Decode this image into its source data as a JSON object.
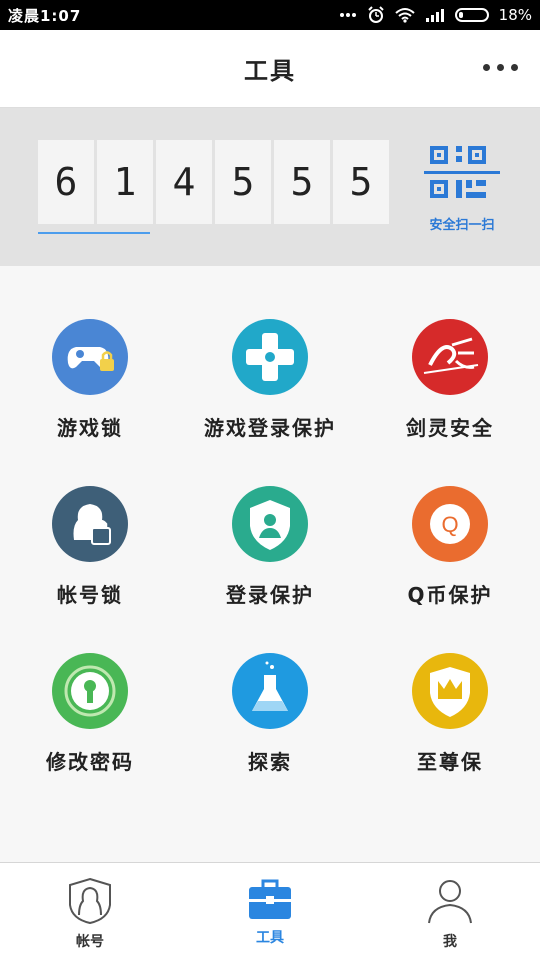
{
  "status_bar": {
    "time": "凌晨1:07",
    "battery": "18%",
    "battery_fraction": 0.18,
    "icons": [
      "dots-icon",
      "alarm-icon",
      "wifi-icon",
      "signal-icon",
      "battery-icon"
    ]
  },
  "header": {
    "title": "工具",
    "more_icon": "more-dots-icon"
  },
  "token": {
    "digits": [
      "6",
      "1",
      "4",
      "5",
      "5",
      "5"
    ],
    "progress_fraction": 0.32,
    "accent": "#4c9ded",
    "scan_label": "安全扫一扫",
    "scan_icon": "qr-code-icon"
  },
  "tools": [
    {
      "label": "游戏锁",
      "icon": "gamepad-lock-icon",
      "color": "#4a86d4"
    },
    {
      "label": "游戏登录保护",
      "icon": "dpad-icon",
      "color": "#21a8c9"
    },
    {
      "label": "剑灵安全",
      "icon": "jianling-logo-icon",
      "color": "#d62a2a"
    },
    {
      "label": "帐号锁",
      "icon": "avatar-lock-icon",
      "color": "#3e5f78"
    },
    {
      "label": "登录保护",
      "icon": "shield-user-icon",
      "color": "#2aab8e"
    },
    {
      "label": "Q币保护",
      "icon": "qcoin-icon",
      "color": "#ea6c2f"
    },
    {
      "label": "修改密码",
      "icon": "keyhole-icon",
      "color": "#49b755"
    },
    {
      "label": "探索",
      "icon": "flask-icon",
      "color": "#1f9ae0"
    },
    {
      "label": "至尊保",
      "icon": "crown-shield-icon",
      "color": "#e8b70d"
    }
  ],
  "bottom_nav": [
    {
      "label": "帐号",
      "icon": "account-shield-icon",
      "active": false
    },
    {
      "label": "工具",
      "icon": "toolbox-icon",
      "active": true
    },
    {
      "label": "我",
      "icon": "person-icon",
      "active": false
    }
  ],
  "colors": {
    "active": "#2b86e0",
    "inactive": "#333333"
  }
}
